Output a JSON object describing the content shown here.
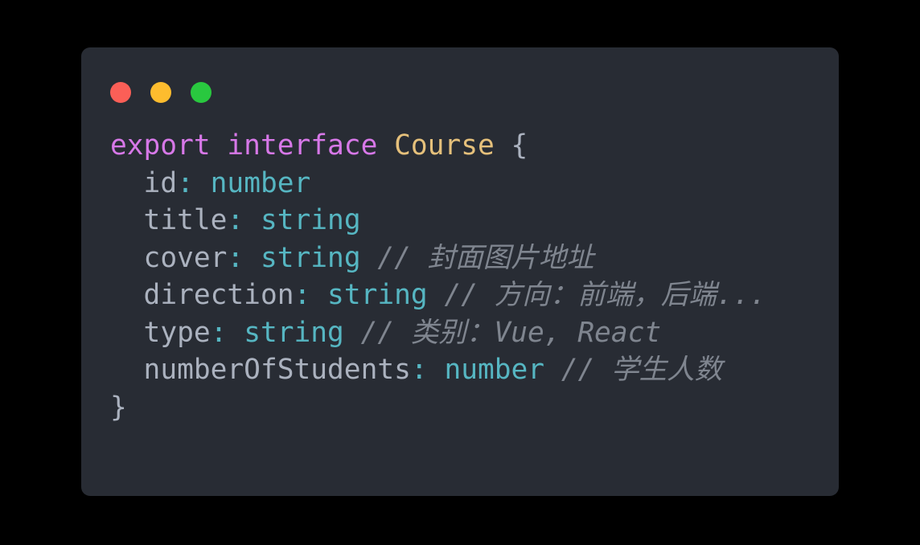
{
  "window": {
    "controls": [
      {
        "name": "close",
        "color": "#fb5f57"
      },
      {
        "name": "minimize",
        "color": "#fdbc2e"
      },
      {
        "name": "maximize",
        "color": "#29c83f"
      }
    ]
  },
  "editor": {
    "language": "typescript",
    "background_color": "#282c34",
    "page_background_color": "#000000",
    "theme_colors": {
      "keyword": "#d778e8",
      "type_name": "#e5c07b",
      "punctuation": "#abb2bf",
      "property": "#abb2bf",
      "colon": "#56b6c2",
      "primitive_type": "#56b6c2",
      "comment": "#7f858f"
    },
    "lines": [
      {
        "n": 1,
        "text": "export interface Course {",
        "tokens": [
          {
            "t": "export",
            "c": "keyword"
          },
          {
            "t": " ",
            "c": "plain"
          },
          {
            "t": "interface",
            "c": "keyword"
          },
          {
            "t": " ",
            "c": "plain"
          },
          {
            "t": "Course",
            "c": "type_name"
          },
          {
            "t": " ",
            "c": "plain"
          },
          {
            "t": "{",
            "c": "punctuation"
          }
        ]
      },
      {
        "n": 2,
        "text": "  id: number",
        "tokens": [
          {
            "t": "  ",
            "c": "plain"
          },
          {
            "t": "id",
            "c": "property"
          },
          {
            "t": ":",
            "c": "colon"
          },
          {
            "t": " ",
            "c": "plain"
          },
          {
            "t": "number",
            "c": "primitive_type"
          }
        ]
      },
      {
        "n": 3,
        "text": "  title: string",
        "tokens": [
          {
            "t": "  ",
            "c": "plain"
          },
          {
            "t": "title",
            "c": "property"
          },
          {
            "t": ":",
            "c": "colon"
          },
          {
            "t": " ",
            "c": "plain"
          },
          {
            "t": "string",
            "c": "primitive_type"
          }
        ]
      },
      {
        "n": 4,
        "text": "  cover: string // 封面图片地址",
        "tokens": [
          {
            "t": "  ",
            "c": "plain"
          },
          {
            "t": "cover",
            "c": "property"
          },
          {
            "t": ":",
            "c": "colon"
          },
          {
            "t": " ",
            "c": "plain"
          },
          {
            "t": "string",
            "c": "primitive_type"
          },
          {
            "t": " ",
            "c": "plain"
          },
          {
            "t": "// 封面图片地址",
            "c": "comment"
          }
        ]
      },
      {
        "n": 5,
        "text": "  direction: string // 方向：前端，后端...",
        "tokens": [
          {
            "t": "  ",
            "c": "plain"
          },
          {
            "t": "direction",
            "c": "property"
          },
          {
            "t": ":",
            "c": "colon"
          },
          {
            "t": " ",
            "c": "plain"
          },
          {
            "t": "string",
            "c": "primitive_type"
          },
          {
            "t": " ",
            "c": "plain"
          },
          {
            "t": "// 方向：前端，后端...",
            "c": "comment"
          }
        ]
      },
      {
        "n": 6,
        "text": "  type: string // 类别：Vue, React",
        "tokens": [
          {
            "t": "  ",
            "c": "plain"
          },
          {
            "t": "type",
            "c": "property"
          },
          {
            "t": ":",
            "c": "colon"
          },
          {
            "t": " ",
            "c": "plain"
          },
          {
            "t": "string",
            "c": "primitive_type"
          },
          {
            "t": " ",
            "c": "plain"
          },
          {
            "t": "// 类别：Vue, React",
            "c": "comment"
          }
        ]
      },
      {
        "n": 7,
        "text": "  numberOfStudents: number // 学生人数",
        "tokens": [
          {
            "t": "  ",
            "c": "plain"
          },
          {
            "t": "numberOfStudents",
            "c": "property"
          },
          {
            "t": ":",
            "c": "colon"
          },
          {
            "t": " ",
            "c": "plain"
          },
          {
            "t": "number",
            "c": "primitive_type"
          },
          {
            "t": " ",
            "c": "plain"
          },
          {
            "t": "// 学生人数",
            "c": "comment"
          }
        ]
      },
      {
        "n": 8,
        "text": "}",
        "tokens": [
          {
            "t": "}",
            "c": "punctuation"
          }
        ]
      }
    ]
  }
}
